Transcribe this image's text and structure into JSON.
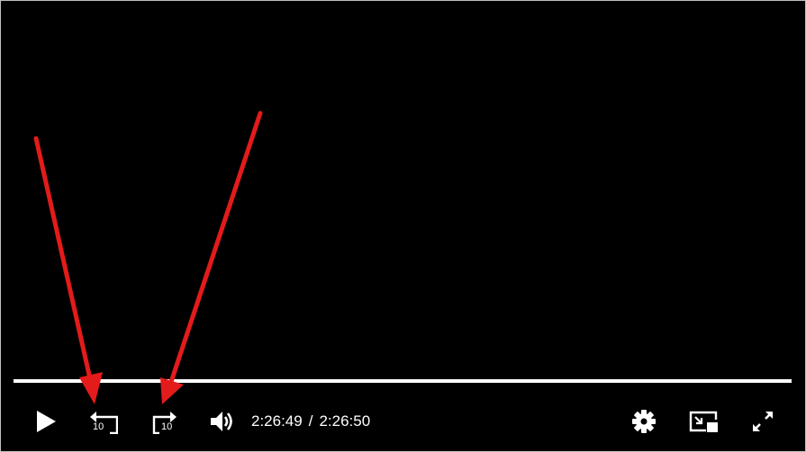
{
  "player": {
    "progress_fraction": 0.9999,
    "current_time": "2:26:49",
    "time_separator": "/",
    "duration": "2:26:50",
    "controls": {
      "play": {
        "icon": "play-icon"
      },
      "rewind": {
        "icon": "rewind-10-icon",
        "seconds_label": "10"
      },
      "forward": {
        "icon": "forward-10-icon",
        "seconds_label": "10"
      },
      "volume": {
        "icon": "volume-icon"
      },
      "settings": {
        "icon": "gear-icon"
      },
      "miniplayer": {
        "icon": "picture-in-picture-icon"
      },
      "fullscreen": {
        "icon": "fullscreen-icon"
      }
    }
  },
  "annotations": {
    "arrow_color": "#e31b1b",
    "arrows": [
      "arrow-to-rewind-button",
      "arrow-to-forward-button"
    ]
  }
}
